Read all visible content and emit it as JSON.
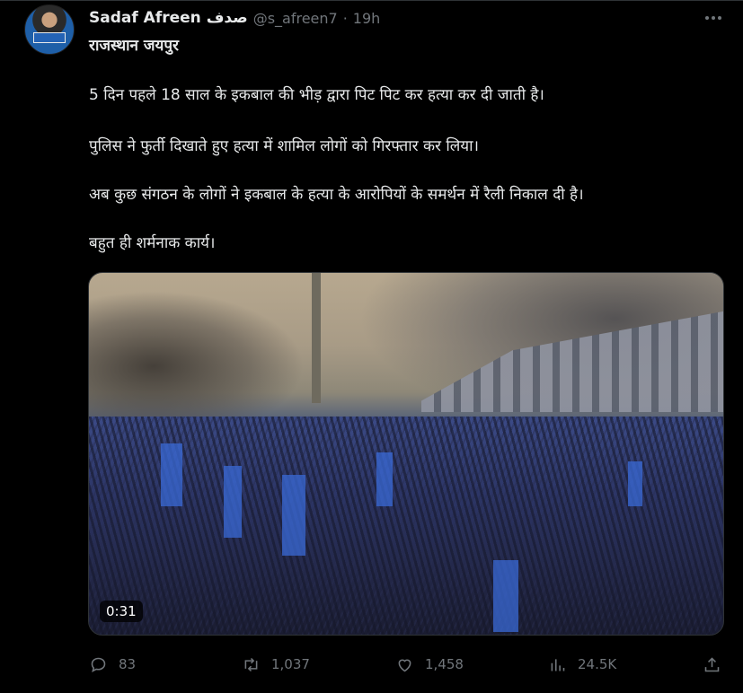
{
  "tweet": {
    "author_name": "Sadaf Afreen صدف",
    "handle": "@s_afreen7",
    "separator": "·",
    "time": "19h",
    "location_line": "राजस्थान जयपुर",
    "paragraphs": [
      "5 दिन पहले 18 साल के इकबाल की भीड़ द्वारा पिट पिट कर हत्या कर दी जाती है।",
      "पुलिस ने फुर्ती दिखाते हुए हत्या में शामिल लोगों को गिरफ्तार कर लिया।",
      "अब कुछ संगठन के लोगों ने इकबाल के हत्या के आरोपियों के समर्थन में रैली निकाल दी है।",
      "बहुत ही शर्मनाक कार्य।"
    ]
  },
  "media": {
    "duration": "0:31"
  },
  "actions": {
    "replies": "83",
    "reposts": "1,037",
    "likes": "1,458",
    "views": "24.5K"
  },
  "icons": {
    "reply": "reply-icon",
    "repost": "repost-icon",
    "like": "heart-icon",
    "views": "analytics-icon",
    "share": "share-icon",
    "more": "more-icon"
  },
  "colors": {
    "background": "#000000",
    "text": "#e7e9ea",
    "muted": "#71767b",
    "divider": "#2f3336"
  }
}
